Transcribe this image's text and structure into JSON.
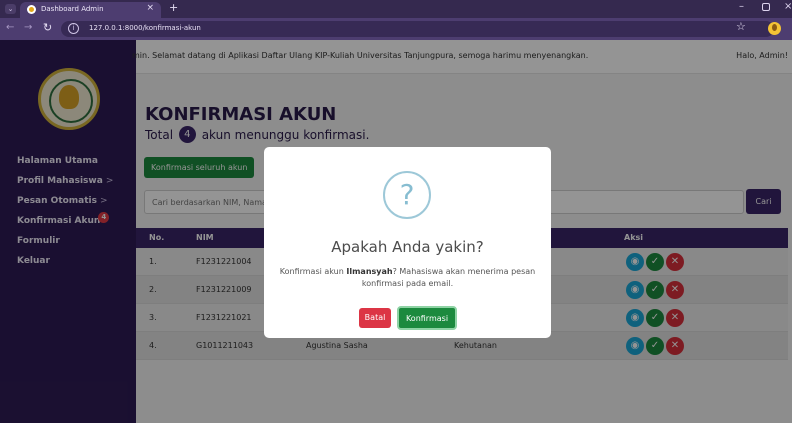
{
  "browser": {
    "tab_title": "Dashboard Admin",
    "url": "127.0.0.1:8000/konfirmasi-akun",
    "tab_close": "×",
    "new_tab": "+"
  },
  "topbar": {
    "marquee": "min. Selamat datang di Aplikasi Daftar Ulang KIP-Kuliah Universitas Tanjungpura, semoga harimu menyenangkan.",
    "greeting": "Halo, Admin!"
  },
  "sidebar": {
    "items": [
      {
        "label": "Halaman Utama"
      },
      {
        "label": "Profil Mahasiswa",
        "caret": ">"
      },
      {
        "label": "Pesan Otomatis",
        "caret": ">"
      },
      {
        "label": "Konfirmasi Akun",
        "badge": "4"
      },
      {
        "label": "Formulir"
      },
      {
        "label": "Keluar"
      }
    ]
  },
  "main": {
    "title": "KONFIRMASI AKUN",
    "subtitle_prefix": "Total",
    "count": "4",
    "subtitle_suffix": "akun menunggu konfirmasi.",
    "confirm_all_label": "Konfirmasi seluruh akun",
    "search_placeholder": "Cari berdasarkan NIM, Nama",
    "search_button": "Cari"
  },
  "table": {
    "headers": {
      "no": "No.",
      "nim": "NIM",
      "aksi": "Aksi"
    },
    "rows": [
      {
        "no": "1.",
        "nim": "F1231221004",
        "name": "",
        "address": ""
      },
      {
        "no": "2.",
        "nim": "F1231221009",
        "name": "",
        "address": ""
      },
      {
        "no": "3.",
        "nim": "F1231221021",
        "name": "",
        "address": ""
      },
      {
        "no": "4.",
        "nim": "G1011211043",
        "name": "Agustina Sasha",
        "address": "Kehutanan"
      }
    ]
  },
  "dialog": {
    "icon": "?",
    "title": "Apakah Anda yakin?",
    "text_before": "Konfirmasi akun ",
    "name": "Ilmansyah",
    "text_after": "? Mahasiswa akan menerima pesan konfirmasi pada email.",
    "cancel_label": "Batal",
    "confirm_label": "Konfirmasi"
  },
  "colors": {
    "sidebar": "#2e1b55",
    "primary": "#3a2568",
    "success": "#1c8a3e",
    "danger": "#dc3545",
    "info": "#1aa8d8"
  }
}
